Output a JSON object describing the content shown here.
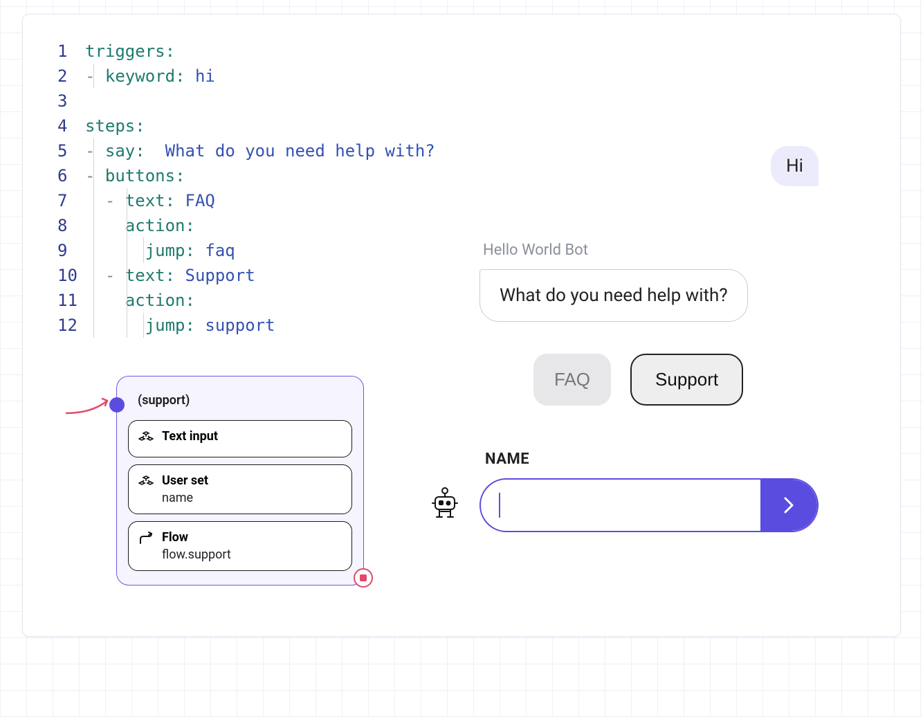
{
  "editor": {
    "lines": [
      {
        "n": 1,
        "segments": [
          [
            "k",
            "triggers"
          ],
          [
            "p",
            ":"
          ]
        ]
      },
      {
        "n": 2,
        "indent": 1,
        "dash": true,
        "segments": [
          [
            "k",
            "keyword"
          ],
          [
            "p",
            ": "
          ],
          [
            "v",
            "hi"
          ]
        ]
      },
      {
        "n": 3,
        "segments": []
      },
      {
        "n": 4,
        "segments": [
          [
            "k",
            "steps"
          ],
          [
            "p",
            ":"
          ]
        ]
      },
      {
        "n": 5,
        "indent": 1,
        "dash": true,
        "segments": [
          [
            "k",
            "say"
          ],
          [
            "p",
            ":  "
          ],
          [
            "v",
            "What do you need help with?"
          ]
        ]
      },
      {
        "n": 6,
        "indent": 1,
        "dash": true,
        "segments": [
          [
            "k",
            "buttons"
          ],
          [
            "p",
            ":"
          ]
        ]
      },
      {
        "n": 7,
        "indent": 2,
        "dash": true,
        "segments": [
          [
            "k",
            "text"
          ],
          [
            "p",
            ": "
          ],
          [
            "v",
            "FAQ"
          ]
        ]
      },
      {
        "n": 8,
        "indent": 2,
        "segments": [
          [
            "k",
            "action"
          ],
          [
            "p",
            ":"
          ]
        ]
      },
      {
        "n": 9,
        "indent": 3,
        "segments": [
          [
            "k",
            "jump"
          ],
          [
            "p",
            ": "
          ],
          [
            "v",
            "faq"
          ]
        ]
      },
      {
        "n": 10,
        "indent": 2,
        "dash": true,
        "segments": [
          [
            "k",
            "text"
          ],
          [
            "p",
            ": "
          ],
          [
            "v",
            "Support"
          ]
        ]
      },
      {
        "n": 11,
        "indent": 2,
        "segments": [
          [
            "k",
            "action"
          ],
          [
            "p",
            ":"
          ]
        ]
      },
      {
        "n": 12,
        "indent": 3,
        "segments": [
          [
            "k",
            "jump"
          ],
          [
            "p",
            ": "
          ],
          [
            "v",
            "support"
          ]
        ]
      }
    ]
  },
  "flow_node": {
    "title": "(support)",
    "steps": [
      {
        "icon": "blocks",
        "label": "Text input"
      },
      {
        "icon": "blocks",
        "label": "User set",
        "sub": "name"
      },
      {
        "icon": "flow",
        "label": "Flow",
        "sub": "flow.support"
      }
    ]
  },
  "chat": {
    "user_message": "Hi",
    "bot_name": "Hello World Bot",
    "bot_message": "What do you need help with?",
    "buttons": [
      {
        "label": "FAQ",
        "selected": false
      },
      {
        "label": "Support",
        "selected": true
      }
    ],
    "prompt_label": "NAME",
    "input_value": ""
  },
  "colors": {
    "accent": "#5b4ce0",
    "key": "#1f7a6f",
    "value": "#3451b2",
    "stop": "#e04a6a"
  }
}
